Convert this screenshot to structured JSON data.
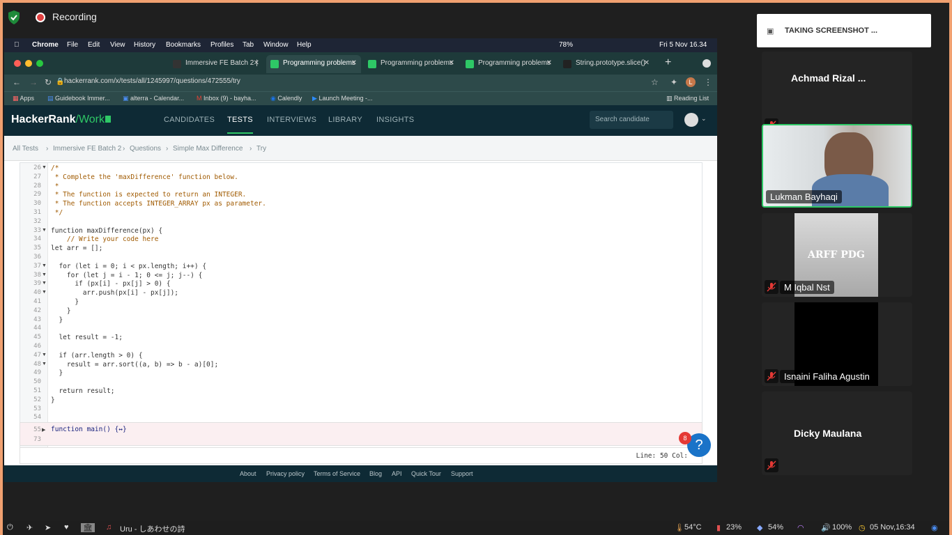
{
  "recording": {
    "label": "Recording"
  },
  "mac_menu": {
    "app": "Chrome",
    "items": [
      "File",
      "Edit",
      "View",
      "History",
      "Bookmarks",
      "Profiles",
      "Tab",
      "Window",
      "Help"
    ],
    "battery": "78%",
    "clock": "Fri 5 Nov  16.34"
  },
  "tabs": [
    {
      "title": "Immersive FE Batch 2 |",
      "color": "#333"
    },
    {
      "title": "Programming problems",
      "color": "#2ec866",
      "active": true
    },
    {
      "title": "Programming problems",
      "color": "#2ec866"
    },
    {
      "title": "Programming problems",
      "color": "#2ec866"
    },
    {
      "title": "String.prototype.slice()",
      "color": "#222"
    }
  ],
  "address": {
    "url": "hackerrank.com/x/tests/all/1245997/questions/472555/try"
  },
  "bookmarks": [
    {
      "label": "Apps"
    },
    {
      "label": "Guidebook Immer..."
    },
    {
      "label": "alterra - Calendar..."
    },
    {
      "label": "Inbox (9) - bayha..."
    },
    {
      "label": "Calendly"
    },
    {
      "label": "Launch Meeting -..."
    }
  ],
  "reading_list": "Reading List",
  "hackerrank": {
    "logo_main": "HackerRank",
    "logo_sub": "/Work",
    "nav": [
      "CANDIDATES",
      "TESTS",
      "INTERVIEWS",
      "LIBRARY",
      "INSIGHTS"
    ],
    "search_placeholder": "Search candidate"
  },
  "breadcrumb": [
    "All Tests",
    "Immersive FE Batch 2",
    "Questions",
    "Simple Max Difference",
    "Try"
  ],
  "code_lines": [
    {
      "n": "26",
      "fold": true,
      "t": "/*"
    },
    {
      "n": "27",
      "t": " * Complete the 'maxDifference' function below."
    },
    {
      "n": "28",
      "t": " *"
    },
    {
      "n": "29",
      "t": " * The function is expected to return an INTEGER."
    },
    {
      "n": "30",
      "t": " * The function accepts INTEGER_ARRAY px as parameter."
    },
    {
      "n": "31",
      "t": " */"
    },
    {
      "n": "32",
      "t": ""
    },
    {
      "n": "33",
      "fold": true,
      "t": "function maxDifference(px) {"
    },
    {
      "n": "34",
      "t": "    // Write your code here"
    },
    {
      "n": "35",
      "t": "let arr = [];"
    },
    {
      "n": "36",
      "t": ""
    },
    {
      "n": "37",
      "fold": true,
      "t": "  for (let i = 0; i < px.length; i++) {"
    },
    {
      "n": "38",
      "fold": true,
      "t": "    for (let j = i - 1; 0 <= j; j--) {"
    },
    {
      "n": "39",
      "fold": true,
      "t": "      if (px[i] - px[j] > 0) {"
    },
    {
      "n": "40",
      "fold": true,
      "t": "        arr.push(px[i] - px[j]);"
    },
    {
      "n": "41",
      "t": "      }"
    },
    {
      "n": "42",
      "t": "    }"
    },
    {
      "n": "43",
      "t": "  }"
    },
    {
      "n": "44",
      "t": ""
    },
    {
      "n": "45",
      "t": "  let result = -1;"
    },
    {
      "n": "46",
      "t": ""
    },
    {
      "n": "47",
      "fold": true,
      "t": "  if (arr.length > 0) {"
    },
    {
      "n": "48",
      "fold": true,
      "t": "    result = arr.sort((a, b) => b - a)[0];"
    },
    {
      "n": "49",
      "t": "  }"
    },
    {
      "n": "50",
      "t": ""
    },
    {
      "n": "51",
      "t": "  return result;"
    },
    {
      "n": "52",
      "t": "}"
    },
    {
      "n": "53",
      "t": ""
    },
    {
      "n": "54",
      "t": ""
    }
  ],
  "collapsed": [
    {
      "n": "55",
      "t": "function main() {↔}"
    },
    {
      "n": "73",
      "t": ""
    }
  ],
  "status": "Line: 50 Col:",
  "help": {
    "badge": "8",
    "icon": "?"
  },
  "site_footer": [
    "About",
    "Privacy policy",
    "Terms of Service",
    "Blog",
    "API",
    "Quick Tour",
    "Support"
  ],
  "screenshot_toast": "TAKING  SCREENSHOT ...",
  "participants": [
    {
      "name": "Achmad Rizal ..."
    },
    {
      "name": "Lukman Bayhaqi"
    },
    {
      "name": "M Iqbal Nst",
      "card_text": "ARFF PDG"
    },
    {
      "name": "Isnaini Faliha Agustin"
    },
    {
      "name": "Dicky Maulana"
    }
  ],
  "taskbar": {
    "music": "Uru - しあわせの詩",
    "temp": "54°C",
    "cpu": "23%",
    "mem": "54%",
    "volume": "100%",
    "clock": "05 Nov,16:34"
  }
}
